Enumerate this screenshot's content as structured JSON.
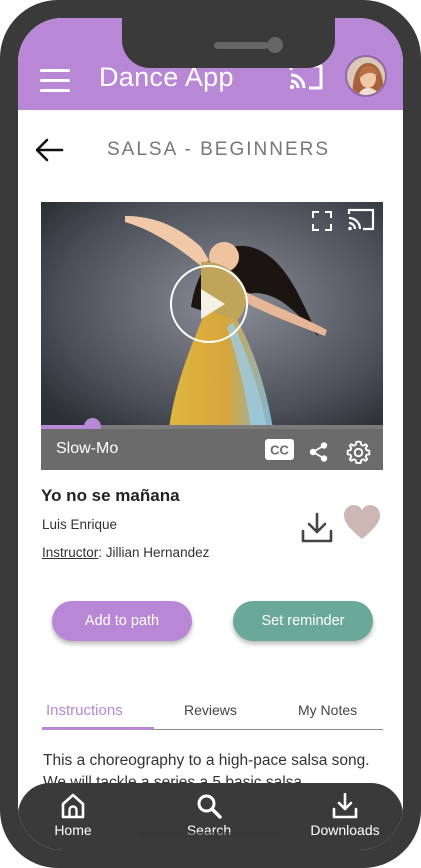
{
  "app": {
    "title": "Dance App"
  },
  "page": {
    "title": "SALSA - BEGINNERS"
  },
  "video": {
    "progress_fraction": 0.15,
    "speed_label": "Slow-Mo",
    "cc_label": "CC"
  },
  "song": {
    "title": "Yo no se mañana",
    "artist": "Luis Enrique",
    "instructor_label": "Instructor",
    "instructor_name": ": Jillian Hernandez"
  },
  "actions": {
    "add_to_path": "Add to path",
    "set_reminder": "Set reminder"
  },
  "tabs": [
    {
      "label": "Instructions",
      "active": true
    },
    {
      "label": "Reviews",
      "active": false
    },
    {
      "label": "My Notes",
      "active": false
    }
  ],
  "instructions": {
    "text": "This a choreography to a high-pace salsa song. We will tackle a series a 5 basic salsa"
  },
  "bottom_nav": [
    {
      "label": "Home",
      "icon": "home-icon"
    },
    {
      "label": "Search",
      "icon": "search-icon"
    },
    {
      "label": "Downloads",
      "icon": "download-icon"
    }
  ],
  "colors": {
    "accent": "#b887d6",
    "secondary": "#6aa898",
    "phone_frame": "#3a3a3a",
    "heart": "#cdb7b5"
  }
}
